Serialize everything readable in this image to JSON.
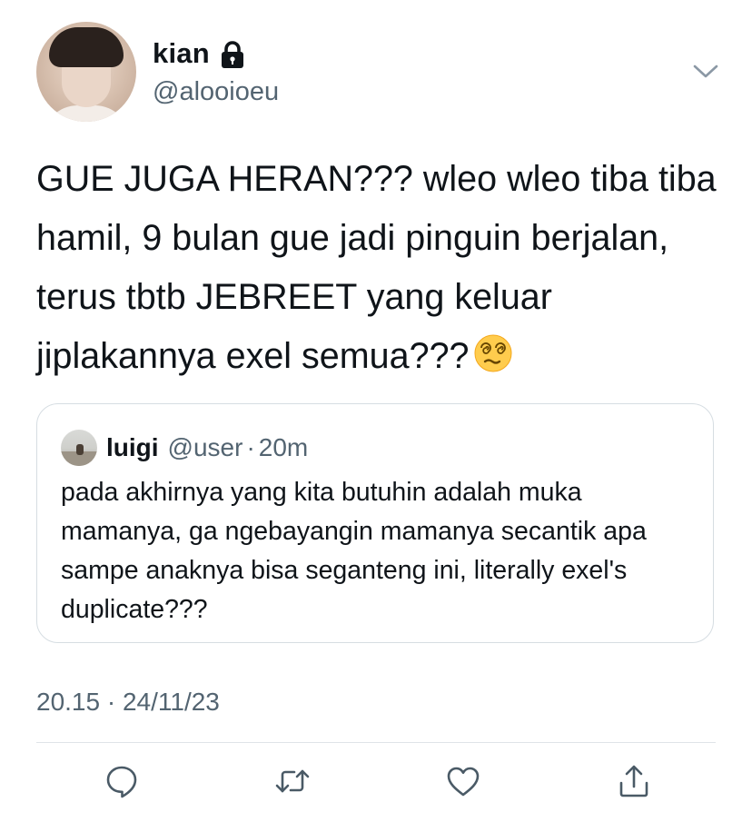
{
  "author": {
    "display_name": "kian",
    "handle": "@alooioeu",
    "protected_icon": "lock-icon"
  },
  "tweet": {
    "text": "GUE JUGA HERAN??? wleo wleo tiba tiba hamil, 9 bulan gue jadi pinguin berjalan, terus tbtb JEBREET yang keluar jiplakannya exel semua???",
    "emoji": "face-with-spiral-eyes-emoji",
    "timestamp": "20.15 · 24/11/23"
  },
  "quoted_tweet": {
    "name": "luigi",
    "handle": "@user",
    "separator": "·",
    "time": "20m",
    "text": "pada akhirnya yang kita butuhin adalah muka mamanya, ga ngebayangin mamanya secantik apa sampe anaknya bisa seganteng ini, literally exel's duplicate???"
  },
  "actions": [
    {
      "name": "reply",
      "icon": "reply-icon"
    },
    {
      "name": "retweet",
      "icon": "retweet-icon"
    },
    {
      "name": "like",
      "icon": "heart-icon"
    },
    {
      "name": "share",
      "icon": "share-icon"
    }
  ],
  "colors": {
    "text": "#0f1419",
    "secondary": "#536471",
    "border": "#d6dde2",
    "icon": "#4a5a66"
  }
}
